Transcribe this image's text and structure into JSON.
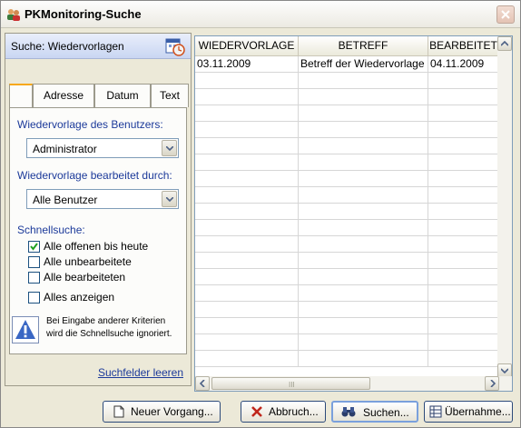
{
  "window": {
    "title": "PKMonitoring-Suche"
  },
  "left_panel": {
    "header_title": "Suche: Wiedervorlagen",
    "tabs": [
      {
        "label": ""
      },
      {
        "label": "Adresse"
      },
      {
        "label": "Datum"
      },
      {
        "label": "Text"
      }
    ],
    "user_label": "Wiedervorlage des Benutzers:",
    "user_value": "Administrator",
    "edited_label": "Wiedervorlage bearbeitet durch:",
    "edited_value": "Alle Benutzer",
    "quick_label": "Schnellsuche:",
    "quick_options": [
      {
        "label": "Alle offenen bis heute",
        "checked": true
      },
      {
        "label": "Alle unbearbeitete",
        "checked": false
      },
      {
        "label": "Alle bearbeiteten",
        "checked": false
      },
      {
        "label": "Alles anzeigen",
        "checked": false
      }
    ],
    "info_text_1": "Bei Eingabe anderer Kriterien",
    "info_text_2": "wird die Schnellsuche ignoriert.",
    "clear_link": "Suchfelder leeren"
  },
  "table": {
    "columns": [
      "WIEDERVORLAGE",
      "BETREFF",
      "BEARBEITET"
    ],
    "rows": [
      [
        "03.11.2009",
        "Betreff der Wiedervorlage",
        "04.11.2009"
      ]
    ],
    "empty_rows": 18,
    "scroll_grip": "III"
  },
  "buttons": {
    "new": "Neuer Vorgang...",
    "cancel": "Abbruch...",
    "search": "Suchen...",
    "apply": "Übernahme..."
  },
  "colors": {
    "accent": "#f7a81b",
    "link": "#1c3a9a",
    "close": "#c0462c"
  }
}
